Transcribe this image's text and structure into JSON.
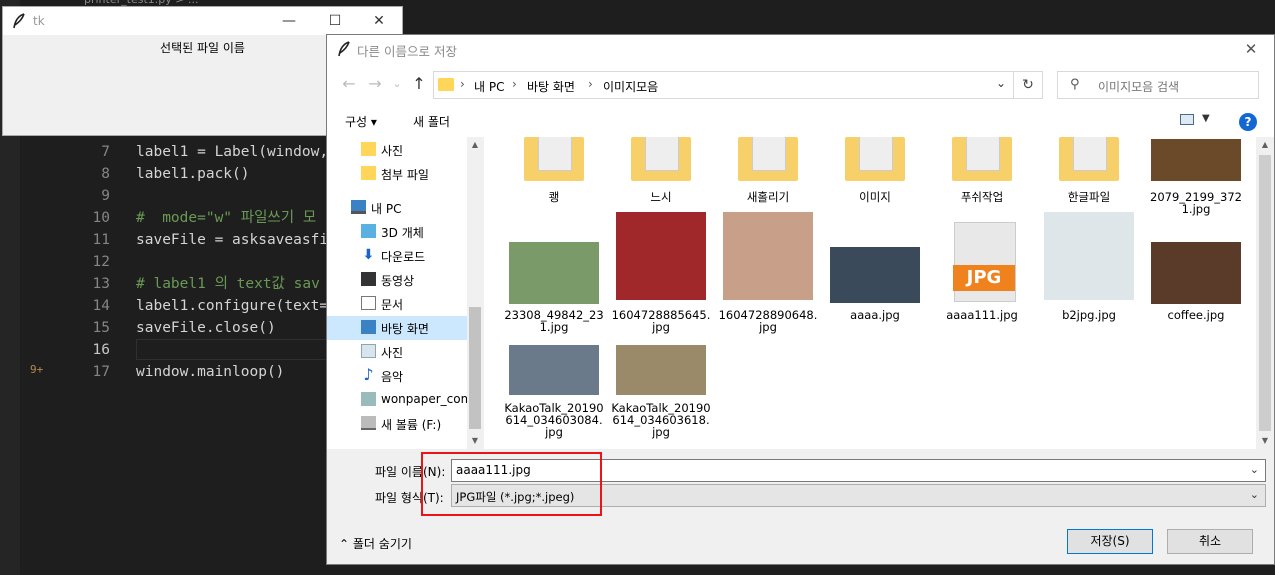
{
  "editor": {
    "tab_label": "printer_test1.py > ...",
    "lines": [
      {
        "num": "7",
        "text": "label1 = Label(window,",
        "style": "code"
      },
      {
        "num": "8",
        "text": "label1.pack()",
        "style": "code"
      },
      {
        "num": "9",
        "text": "",
        "style": "code"
      },
      {
        "num": "10",
        "text": "#  mode=\"w\" 파일쓰기 모",
        "style": "comment"
      },
      {
        "num": "11",
        "text": "saveFile = asksaveasfi",
        "style": "code"
      },
      {
        "num": "12",
        "text": "",
        "style": "code"
      },
      {
        "num": "13",
        "text": "# label1 의 text값 sav",
        "style": "comment"
      },
      {
        "num": "14",
        "text": "label1.configure(text=",
        "style": "code"
      },
      {
        "num": "15",
        "text": "saveFile.close()",
        "style": "code"
      },
      {
        "num": "16",
        "text": "",
        "style": "current"
      },
      {
        "num": "17",
        "text": "window.mainloop()",
        "style": "code"
      }
    ],
    "change_marker": "9+"
  },
  "tk_window": {
    "title": "tk",
    "label1": "선택된 파일 이름",
    "minimize": "—",
    "maximize": "☐",
    "close": "✕"
  },
  "dialog": {
    "title": "다른 이름으로 저장",
    "close": "✕",
    "nav": {
      "back": "←",
      "forward": "→",
      "recent": "⌄",
      "up": "↑",
      "refresh": "↻"
    },
    "breadcrumbs": [
      "내 PC",
      "바탕 화면",
      "이미지모음"
    ],
    "search_placeholder": "이미지모음 검색",
    "toolbar": {
      "organize": "구성 ▾",
      "new_folder": "새 폴더",
      "help": "?"
    },
    "nav_pane": [
      {
        "label": "사진",
        "icon": "folder-icon",
        "selected": false
      },
      {
        "label": "첨부 파일",
        "icon": "folder-icon",
        "selected": false
      },
      {
        "label": "",
        "icon": "",
        "selected": false
      },
      {
        "label": "내 PC",
        "icon": "pc-icon",
        "selected": false
      },
      {
        "label": "3D 개체",
        "icon": "cube-icon",
        "selected": false
      },
      {
        "label": "다운로드",
        "icon": "download-icon",
        "selected": false
      },
      {
        "label": "동영상",
        "icon": "video-icon",
        "selected": false
      },
      {
        "label": "문서",
        "icon": "document-icon",
        "selected": false
      },
      {
        "label": "바탕 화면",
        "icon": "desktop-icon",
        "selected": true
      },
      {
        "label": "사진",
        "icon": "pictures-icon",
        "selected": false
      },
      {
        "label": "음악",
        "icon": "music-icon",
        "selected": false
      },
      {
        "label": "wonpaper_com",
        "icon": "network-icon",
        "selected": false
      },
      {
        "label": "새 볼륨 (F:)",
        "icon": "drive-icon",
        "selected": false
      }
    ],
    "folders": [
      {
        "name": "쾡"
      },
      {
        "name": "느시"
      },
      {
        "name": "새홀리기"
      },
      {
        "name": "이미지"
      },
      {
        "name": "푸쉬작업"
      },
      {
        "name": "한글파일"
      },
      {
        "name": "2079_2199_3721.jpg"
      }
    ],
    "files": [
      {
        "name": "23308_49842_231.jpg",
        "thumb_color": "#7a9a6a"
      },
      {
        "name": "1604728885645.jpg",
        "thumb_color": "#a0282a"
      },
      {
        "name": "1604728890648.jpg",
        "thumb_color": "#c8a08a"
      },
      {
        "name": "aaaa.jpg",
        "thumb_color": "#3a4a5a"
      },
      {
        "name": "aaaa111.jpg",
        "thumb_color": "#e8e8e8"
      },
      {
        "name": "b2jpg.jpg",
        "thumb_color": "#dfe6ea"
      },
      {
        "name": "coffee.jpg",
        "thumb_color": "#5a3a28"
      },
      {
        "name": "KakaoTalk_20190614_034603084.jpg",
        "thumb_color": "#6a7a8a"
      },
      {
        "name": "KakaoTalk_20190614_034603618.jpg",
        "thumb_color": "#9a8a6a"
      }
    ],
    "jpg_badge": "JPG",
    "filename_label": "파일 이름(N):",
    "filename_value": "aaaa111.jpg",
    "filetype_label": "파일 형식(T):",
    "filetype_value": "JPG파일 (*.jpg;*.jpeg)",
    "hide_folders": "폴더 숨기기",
    "save_button": "저장(S)",
    "cancel_button": "취소",
    "highlight_color": "#e8161b"
  }
}
